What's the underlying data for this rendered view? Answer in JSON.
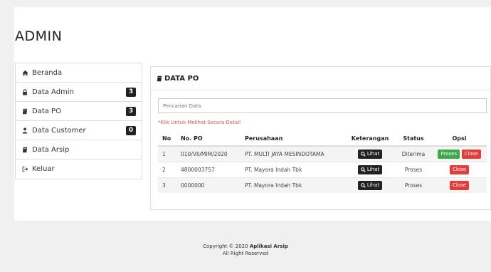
{
  "header": {
    "title": "ADMIN"
  },
  "sidebar": {
    "items": [
      {
        "icon": "home-icon",
        "label": "Beranda",
        "badge": null
      },
      {
        "icon": "lock-icon",
        "label": "Data Admin",
        "badge": "3"
      },
      {
        "icon": "book-icon",
        "label": "Data PO",
        "badge": "3"
      },
      {
        "icon": "user-icon",
        "label": "Data Customer",
        "badge": "0"
      },
      {
        "icon": "book-icon",
        "label": "Data Arsip",
        "badge": null
      },
      {
        "icon": "sign-out-icon",
        "label": "Keluar",
        "badge": null
      }
    ]
  },
  "main": {
    "title": "DATA PO",
    "search": {
      "placeholder": "Pencarian Data",
      "value": ""
    },
    "hint": "*Klik Untuk Melihat Secara Detail",
    "table": {
      "columns": [
        "No",
        "No. PO",
        "Perusahaan",
        "Keterangan",
        "Status",
        "Opsi"
      ],
      "rows": [
        {
          "no": "1",
          "po": "010/VII/MIM/2020",
          "company": "PT. MULTI JAYA MESINDOTAMA",
          "detail_label": "Lihat",
          "status": "Diterima",
          "actions": [
            "Proses",
            "Close"
          ]
        },
        {
          "no": "2",
          "po": "4800003757",
          "company": "PT. Mayora Indah Tbk",
          "detail_label": "Lihat",
          "status": "Proses",
          "actions": [
            "Close"
          ]
        },
        {
          "no": "3",
          "po": "0000000",
          "company": "PT. Mayora Indah Tbk",
          "detail_label": "Lihat",
          "status": "Proses",
          "actions": [
            "Close"
          ]
        }
      ]
    }
  },
  "footer": {
    "prefix": "Copyright © 2020 ",
    "brand": "Aplikasi Arsip",
    "line2": "All Right Reserved"
  },
  "colors": {
    "badge": "#222222",
    "proses_button": "#3ea84a",
    "close_button": "#e33c3c",
    "hint_text": "#e05050"
  }
}
